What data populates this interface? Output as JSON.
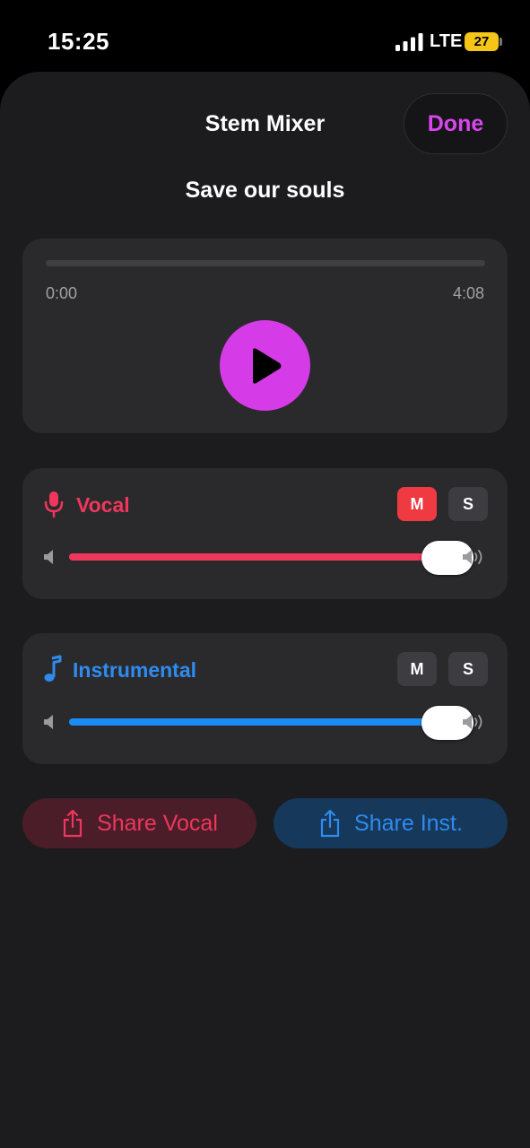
{
  "status_bar": {
    "time": "15:25",
    "network": "LTE",
    "battery": "27",
    "icons": [
      "signal-bars-icon",
      "battery-charging-icon"
    ]
  },
  "header": {
    "title": "Stem Mixer",
    "done_label": "Done"
  },
  "song": {
    "title": "Save our souls"
  },
  "player": {
    "current_time": "0:00",
    "duration": "4:08",
    "progress": 0,
    "play_icon": "play-icon"
  },
  "stems": {
    "vocal": {
      "label": "Vocal",
      "icon": "microphone-icon",
      "mute_label": "M",
      "solo_label": "S",
      "muted": true,
      "soloed": false,
      "volume": 1.0
    },
    "instrumental": {
      "label": "Instrumental",
      "icon": "music-note-icon",
      "mute_label": "M",
      "solo_label": "S",
      "muted": false,
      "soloed": false,
      "volume": 1.0
    }
  },
  "share": {
    "vocal_label": "Share Vocal",
    "inst_label": "Share Inst.",
    "icon": "share-icon"
  },
  "colors": {
    "accent": "#d63be8",
    "vocal": "#f0365c",
    "instrumental": "#1a8cf5",
    "mute_active": "#ef3a42",
    "sheet_bg": "#1c1c1e",
    "card_bg": "#2a2a2d"
  }
}
